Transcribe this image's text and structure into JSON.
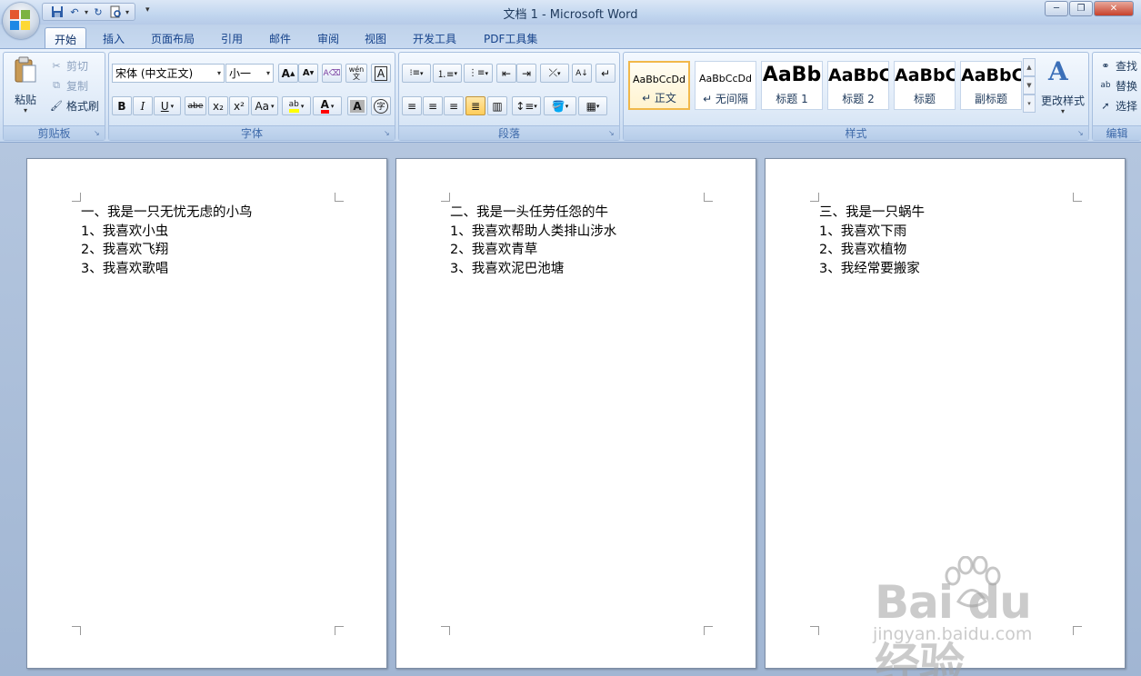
{
  "window": {
    "title": "文档 1 - Microsoft Word",
    "controls": [
      "minimize",
      "restore",
      "close"
    ]
  },
  "quick_access": {
    "icons": [
      "save-icon",
      "undo-icon",
      "redo-icon",
      "print-preview-icon"
    ]
  },
  "tabs": [
    {
      "label": "开始",
      "active": true
    },
    {
      "label": "插入"
    },
    {
      "label": "页面布局"
    },
    {
      "label": "引用"
    },
    {
      "label": "邮件"
    },
    {
      "label": "审阅"
    },
    {
      "label": "视图"
    },
    {
      "label": "开发工具"
    },
    {
      "label": "PDF工具集"
    }
  ],
  "clipboard": {
    "group_label": "剪贴板",
    "paste": "粘贴",
    "cut": "剪切",
    "copy": "复制",
    "format_painter": "格式刷"
  },
  "font": {
    "group_label": "字体",
    "font_name": "宋体 (中文正文)",
    "font_size": "小一",
    "bold": "B",
    "italic": "I",
    "underline": "U",
    "strikethrough": "abe",
    "subscript": "x₂",
    "superscript": "x²",
    "change_case": "Aa",
    "pinyin": "wén\n文",
    "grow_font": "A",
    "shrink_font": "A",
    "char_border": "A",
    "char_shading": "A",
    "enclose": "字",
    "highlight_color": "#ffff00",
    "font_color": "#ff0000"
  },
  "paragraph": {
    "group_label": "段落"
  },
  "styles": {
    "group_label": "样式",
    "items": [
      {
        "sample": "AaBbCcDd",
        "name": "↵ 正文",
        "selected": true
      },
      {
        "sample": "AaBbCcDd",
        "name": "↵ 无间隔"
      },
      {
        "sample": "AaBb",
        "name": "标题 1"
      },
      {
        "sample": "AaBbC",
        "name": "标题 2"
      },
      {
        "sample": "AaBbC",
        "name": "标题"
      },
      {
        "sample": "AaBbC",
        "name": "副标题"
      }
    ],
    "change_styles": "更改样式"
  },
  "editing": {
    "group_label": "编辑",
    "find": "查找",
    "replace": "替换",
    "select": "选择"
  },
  "pages": [
    {
      "lines": [
        "一、我是一只无忧无虑的小鸟",
        "1、我喜欢小虫",
        "2、我喜欢飞翔",
        "3、我喜欢歌唱"
      ]
    },
    {
      "lines": [
        "二、我是一头任劳任怨的牛",
        "1、我喜欢帮助人类排山涉水",
        "2、我喜欢青草",
        "3、我喜欢泥巴池塘"
      ]
    },
    {
      "lines": [
        "三、我是一只蜗牛",
        "1、我喜欢下雨",
        "2、我喜欢植物",
        "3、我经常要搬家"
      ]
    }
  ],
  "watermark": {
    "logo": "Bai du 经验",
    "url": "jingyan.baidu.com"
  }
}
